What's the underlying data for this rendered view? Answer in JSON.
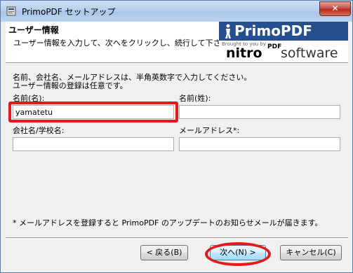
{
  "window": {
    "title": "PrimoPDF セットアップ"
  },
  "header": {
    "title": "ユーザー情報",
    "subtitle": "ユーザー情報を入力して、次へをクリックし、続行して下さい。",
    "logo": {
      "brand": "PrimoPDF",
      "brought_by": "Brought to you by",
      "nitro": "nitro",
      "pdf": "PDF",
      "software": "software"
    }
  },
  "form": {
    "intro_line1": "名前、会社名、メールアドレスは、半角英数字で入力してください。",
    "intro_line2": "ユーザー情報の登録は任意です。",
    "first_name_label": "名前(名):",
    "first_name_value": "yamatetu",
    "last_name_label": "名前(姓):",
    "last_name_value": "",
    "company_label": "会社名/学校名:",
    "company_value": "",
    "email_label": "メールアドレス*:",
    "email_value": "",
    "note": "* メールアドレスを登録すると PrimoPDF のアップデートのお知らせメールが届きます。"
  },
  "buttons": {
    "back": "< 戻る(B)",
    "next": "次へ(N) >",
    "cancel": "キャンセル(C)"
  },
  "colors": {
    "highlight": "#e41a1a",
    "title_bar": "#b8d0ec",
    "logo_bg": "#264f8d"
  }
}
